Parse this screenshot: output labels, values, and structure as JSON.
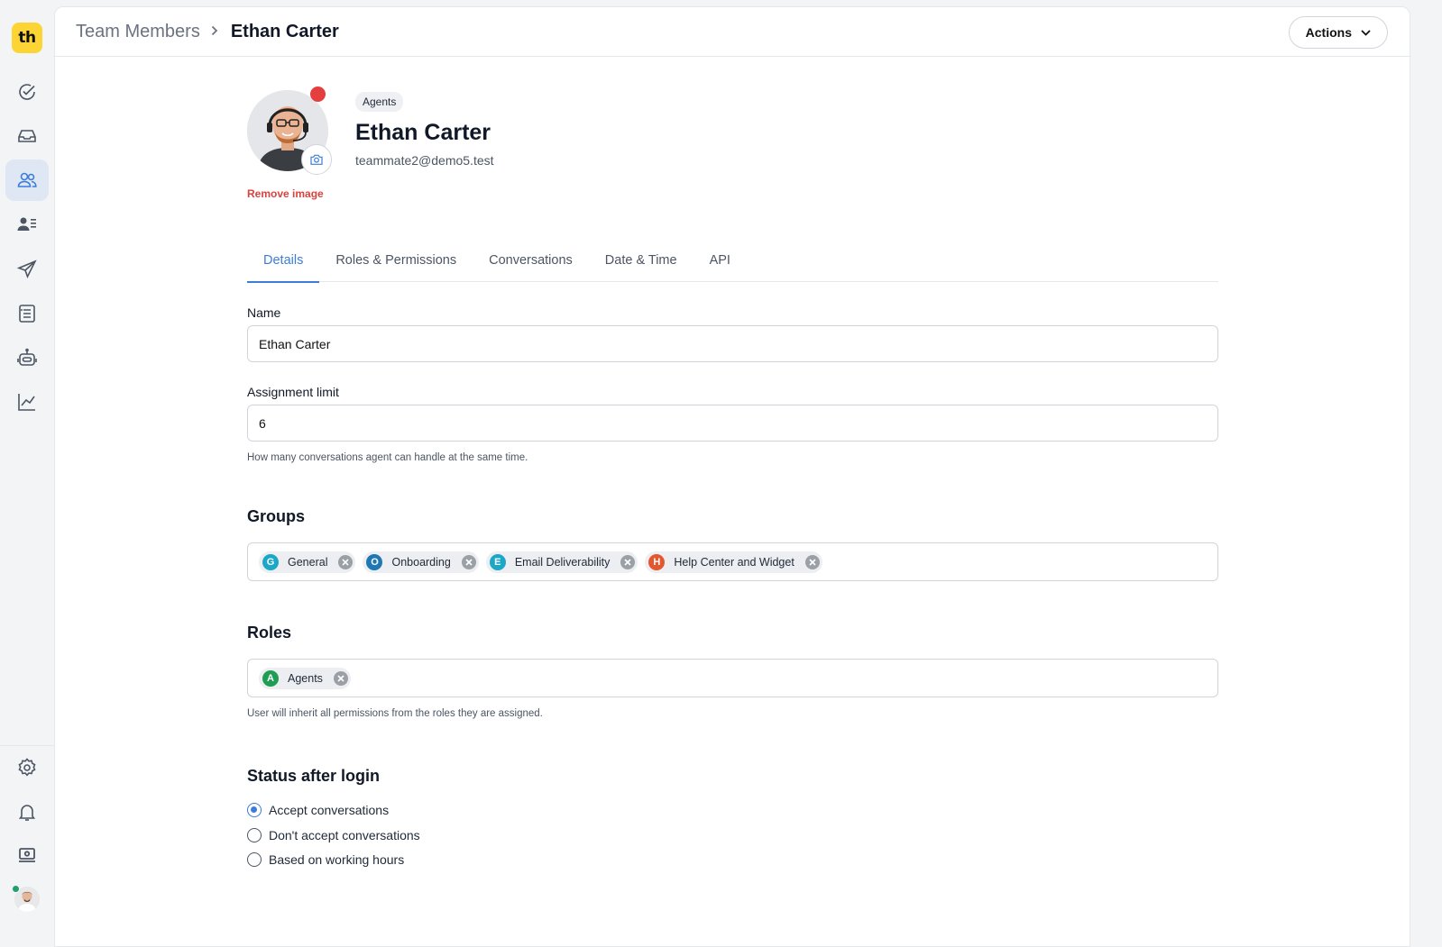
{
  "app": {
    "logo_text": "th",
    "logo_color": "#fcd535",
    "accent_color": "#3b7dd8"
  },
  "sidebar": {
    "items": [
      {
        "icon": "check-circle-icon"
      },
      {
        "icon": "inbox-icon"
      },
      {
        "icon": "team-icon",
        "active": true
      },
      {
        "icon": "contacts-icon"
      },
      {
        "icon": "send-icon"
      },
      {
        "icon": "list-icon"
      },
      {
        "icon": "bot-icon"
      },
      {
        "icon": "chart-icon"
      }
    ],
    "bottom_items": [
      {
        "icon": "gear-icon"
      },
      {
        "icon": "bell-icon"
      },
      {
        "icon": "billing-icon"
      },
      {
        "icon": "user-avatar"
      }
    ]
  },
  "header": {
    "breadcrumb_parent": "Team Members",
    "breadcrumb_current": "Ethan Carter",
    "actions_label": "Actions"
  },
  "profile": {
    "role_badge": "Agents",
    "name": "Ethan Carter",
    "email": "teammate2@demo5.test",
    "remove_image_label": "Remove image",
    "status_color": "#e53e3e"
  },
  "tabs": [
    {
      "label": "Details",
      "active": true
    },
    {
      "label": "Roles & Permissions"
    },
    {
      "label": "Conversations"
    },
    {
      "label": "Date & Time"
    },
    {
      "label": "API"
    }
  ],
  "form": {
    "name_label": "Name",
    "name_value": "Ethan Carter",
    "limit_label": "Assignment limit",
    "limit_value": "6",
    "limit_help": "How many conversations agent can handle at the same time.",
    "groups_title": "Groups",
    "groups": [
      {
        "initial": "G",
        "label": "General",
        "color": "#1ba7c7"
      },
      {
        "initial": "O",
        "label": "Onboarding",
        "color": "#1f78b4"
      },
      {
        "initial": "E",
        "label": "Email Deliverability",
        "color": "#1ba7c7"
      },
      {
        "initial": "H",
        "label": "Help Center and Widget",
        "color": "#e4572e"
      }
    ],
    "roles_title": "Roles",
    "roles": [
      {
        "initial": "A",
        "label": "Agents",
        "color": "#1f9d55"
      }
    ],
    "roles_help": "User will inherit all permissions from the roles they are assigned.",
    "status_title": "Status after login",
    "status_options": [
      {
        "label": "Accept conversations",
        "checked": true
      },
      {
        "label": "Don't accept conversations",
        "checked": false
      },
      {
        "label": "Based on working hours",
        "checked": false
      }
    ]
  }
}
